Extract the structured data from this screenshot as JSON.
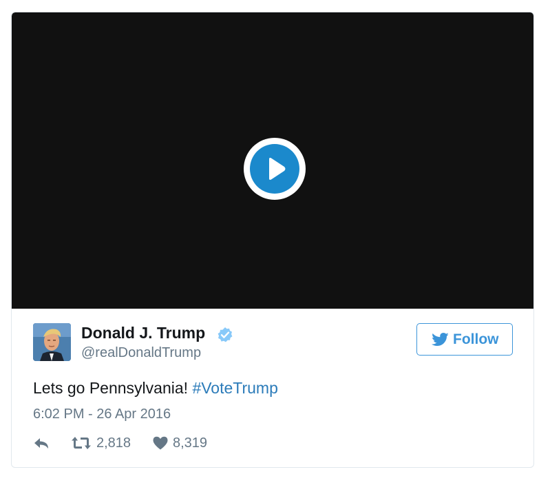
{
  "video": {
    "play_icon": "play-icon",
    "colors": {
      "background": "#111111",
      "play": "#1b89cc"
    }
  },
  "author": {
    "name": "Donald J. Trump",
    "handle": "@realDonaldTrump",
    "verified_icon": "verified-badge-icon"
  },
  "follow": {
    "label": "Follow",
    "icon": "twitter-bird-icon",
    "color": "#3b94d9"
  },
  "tweet": {
    "text": "Lets go Pennsylvania! ",
    "hashtag": "#VoteTrump",
    "timestamp": "6:02 PM - 26 Apr 2016"
  },
  "actions": {
    "reply_icon": "reply-icon",
    "retweet_icon": "retweet-icon",
    "retweet_count": "2,818",
    "like_icon": "heart-icon",
    "like_count": "8,319"
  }
}
